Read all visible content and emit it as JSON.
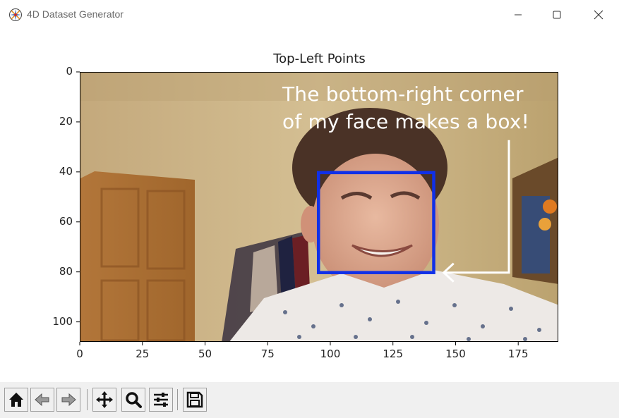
{
  "window": {
    "title": "4D Dataset Generator",
    "controls": {
      "minimize": "minimize-icon",
      "maximize": "maximize-icon",
      "close": "close-icon"
    }
  },
  "plot": {
    "title": "Top-Left Points",
    "annotation": {
      "line1": "The bottom-right corner",
      "line2": "of my face makes a box!"
    },
    "x_ticks": [
      "0",
      "25",
      "50",
      "75",
      "100",
      "125",
      "150",
      "175"
    ],
    "y_ticks": [
      "0",
      "20",
      "40",
      "60",
      "80",
      "100"
    ],
    "xlim": [
      0,
      191
    ],
    "ylim": [
      108,
      0
    ],
    "face_box": {
      "x0": 95,
      "y0": 40,
      "x1": 141,
      "y1": 80,
      "color": "#1030e8"
    },
    "arrow": {
      "from": [
        171,
        27
      ],
      "corner": [
        171,
        80
      ],
      "to": [
        145,
        80
      ],
      "color": "#ffffff"
    }
  },
  "toolbar": {
    "buttons": [
      "home-icon",
      "back-icon",
      "forward-icon",
      "pan-icon",
      "zoom-icon",
      "configure-subplots-icon",
      "save-icon"
    ]
  }
}
